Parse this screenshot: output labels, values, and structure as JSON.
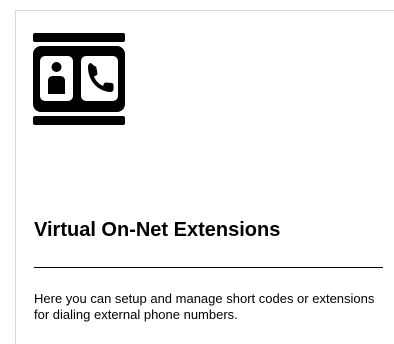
{
  "card": {
    "icon": "contact-phone-icon",
    "title": "Virtual On-Net Extensions",
    "description": "Here you can setup and manage short codes or extensions for dialing external phone numbers."
  },
  "colors": {
    "text": "#000000",
    "icon": "#000000",
    "border": "#d9d9d9",
    "background": "#ffffff"
  }
}
